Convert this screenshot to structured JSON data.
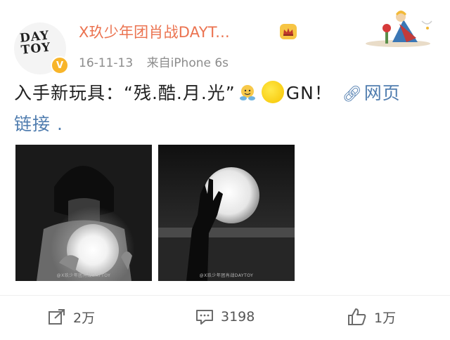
{
  "post": {
    "avatar_logo_line1": "DAY",
    "avatar_logo_line2": "TOY",
    "username": "X玖少年团肖战DAYT...",
    "date": "16-11-13",
    "source": "来自iPhone 6s",
    "text_main": "入手新玩具：“残.酷.月.光”",
    "text_gn": "GN！",
    "link_label": "网页",
    "text_line2": "链接 ."
  },
  "images": [
    {
      "caption": "@X玖少年团肖战DAYTOY"
    },
    {
      "caption": "@X玖少年团肖战DAYTOY"
    }
  ],
  "actions": {
    "share_count": "2万",
    "comment_count": "3198",
    "like_count": "1万"
  },
  "icons": {
    "verified": "verified-badge-icon",
    "crown": "crown-badge-icon",
    "link": "link-icon",
    "share": "share-icon",
    "comment": "comment-icon",
    "like": "thumbs-up-icon"
  },
  "colors": {
    "username": "#eb7350",
    "link": "#507daf",
    "meta": "#8c8c8c",
    "verified": "#f8b52a"
  }
}
